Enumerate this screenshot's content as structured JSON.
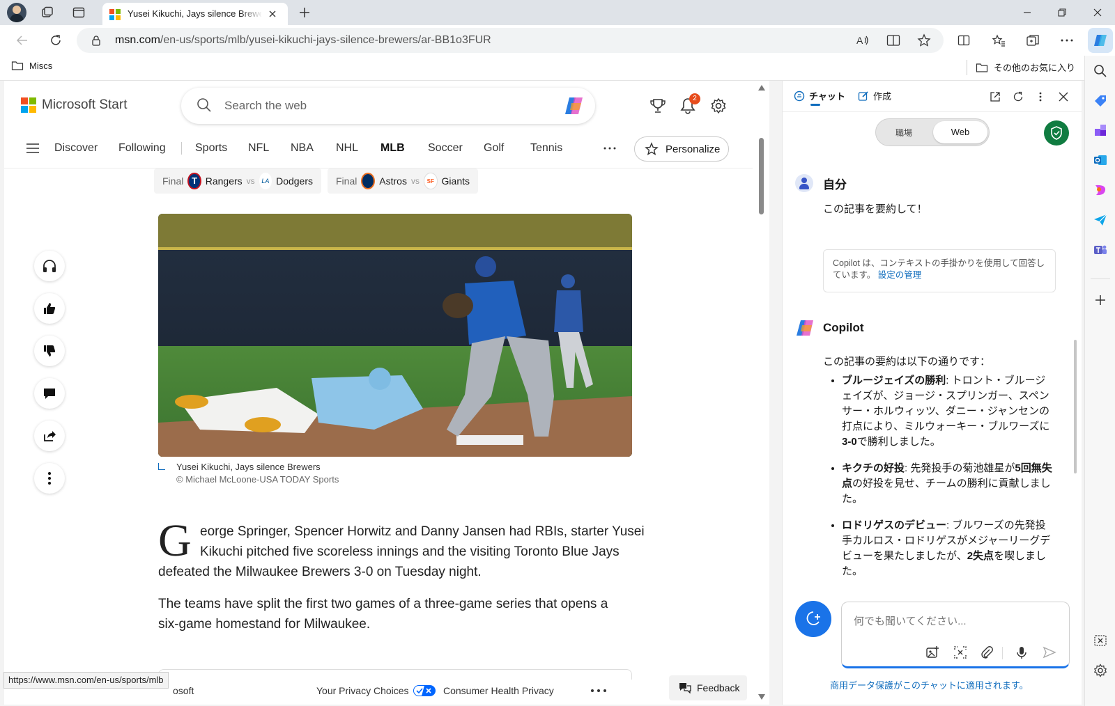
{
  "browser": {
    "tab_title": "Yusei Kikuchi, Jays silence Brewers",
    "url_host": "msn.com",
    "url_path": "/en-us/sports/mlb/yusei-kikuchi-jays-silence-brewers/ar-BB1o3FUR",
    "fav_folder": "Miscs",
    "other_favorites": "その他のお気に入り",
    "status_url": "https://www.msn.com/en-us/sports/mlb"
  },
  "msn": {
    "brand": "Microsoft Start",
    "search_placeholder": "Search the web",
    "notif_count": "2",
    "nav": [
      "Discover",
      "Following",
      "Sports",
      "NFL",
      "NBA",
      "NHL",
      "MLB",
      "Soccer",
      "Golf",
      "Tennis"
    ],
    "active_nav": "MLB",
    "personalize": "Personalize",
    "scores": [
      {
        "status": "Final",
        "team1": "Rangers",
        "vs": "vs",
        "team2": "Dodgers"
      },
      {
        "status": "Final",
        "team1": "Astros",
        "vs": "vs",
        "team2": "Giants"
      }
    ],
    "caption": "Yusei Kikuchi, Jays silence Brewers",
    "credit": "© Michael McLoone-USA TODAY Sports",
    "drop_cap": "G",
    "para1": "eorge Springer, Spencer Horwitz and Danny Jansen had RBIs, starter Yusei Kikuchi pitched five scoreless innings and the visiting Toronto Blue Jays defeated the Milwaukee Brewers 3-0 on Tuesday night.",
    "para1_line1": "eorge Springer, Spencer Horwitz and Danny Jansen had RBIs, starter Yusei",
    "para1_line2": "Kikuchi pitched five scoreless innings and the visiting Toronto Blue Jays",
    "para1_line3": "defeated the Milwaukee Brewers 3-0 on Tuesday night.",
    "para2": "The teams have split the first two games of a three-game series that opens a six-game homestand for Milwaukee.",
    "footer_left": "osoft",
    "privacy_choices": "Your Privacy Choices",
    "consumer_health": "Consumer Health Privacy",
    "feedback": "Feedback"
  },
  "copilot": {
    "tab_chat": "チャット",
    "tab_compose": "作成",
    "toggle_work": "職場",
    "toggle_web": "Web",
    "user_name": "自分",
    "user_msg": "この記事を要約して！",
    "context_note": "Copilot は、コンテキストの手掛かりを使用して回答しています。",
    "context_link": "設定の管理",
    "bot_name": "Copilot",
    "intro": "この記事の要約は以下の通りです：",
    "bullets": [
      {
        "head": "ブルージェイズの勝利",
        "body_pre": ": トロント・ブルージェイズが、ジョージ・スプリンガー、スペンサー・ホルウィッツ、ダニー・ジャンセンの打点により、ミルウォーキー・ブルワーズに",
        "bold": "3-0",
        "body_post": "で勝利しました。"
      },
      {
        "head": "キクチの好投",
        "body_pre": ": 先発投手の菊池雄星が",
        "bold": "5回無失点",
        "body_post": "の好投を見せ、チームの勝利に貢献しました。"
      },
      {
        "head": "ロドリゲスのデビュー",
        "body_pre": ": ブルワーズの先発投手カルロス・ロドリゲスがメジャーリーグデビューを果たしましたが、",
        "bold": "2失点",
        "body_post": "を喫しました。"
      }
    ],
    "input_placeholder": "何でも聞いてください...",
    "data_protection": "商用データ保護がこのチャットに適用されます。"
  },
  "colors": {
    "accent": "#0f6cbd",
    "copilot_blue": "#1a73e8",
    "notif": "#e74c1c"
  }
}
